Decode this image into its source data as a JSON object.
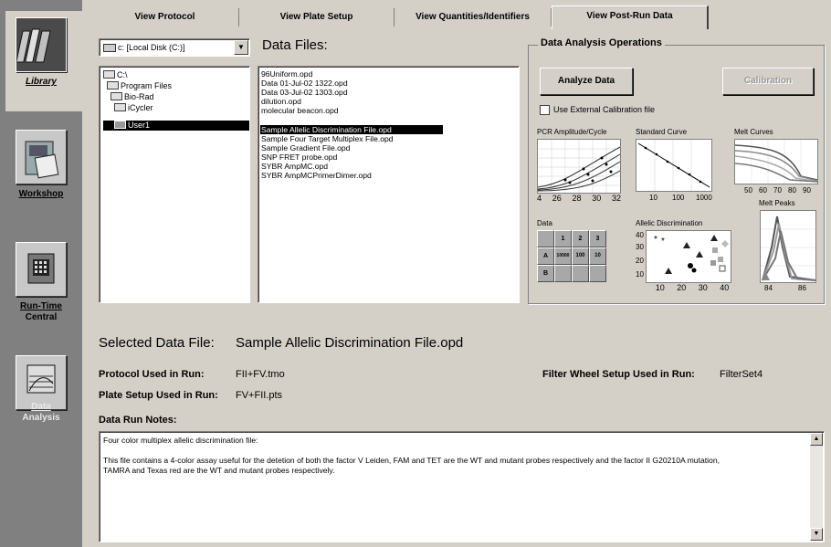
{
  "nav": {
    "library": "Library",
    "workshop": "Workshop",
    "runtime_line1": "Run-Time",
    "runtime_line2": "Central",
    "analysis_line1": "Data",
    "analysis_line2": "Analysis"
  },
  "tabs": [
    "View Protocol",
    "View Plate Setup",
    "View Quantities/Identifiers",
    "View Post-Run Data"
  ],
  "drive": {
    "value": "c: [Local Disk (C:)]"
  },
  "tree": [
    "C:\\",
    "Program Files",
    "Bio-Rad",
    "iCycler",
    "User1"
  ],
  "data_files_header": "Data Files:",
  "files": [
    "96Uniform.opd",
    "Data 01-Jul-02 1322.opd",
    "Data 03-Jul-02 1303.opd",
    "dilution.opd",
    "molecular beacon.opd",
    "Sample Allelic Discrimination File.opd",
    "Sample Four Target Multiplex File.opd",
    "Sample Gradient File.opd",
    "SNP FRET probe.opd",
    "SYBR AmpMC.opd",
    "SYBR AmpMCPrimerDimer.opd"
  ],
  "ops": {
    "title": "Data Analysis Operations",
    "analyze": "Analyze Data",
    "calibration": "Calibration",
    "use_external": "Use External  Calibration file",
    "pcr": "PCR Amplitude/Cycle",
    "pcr_ticks": [
      "4",
      "26",
      "28",
      "30",
      "32"
    ],
    "std": "Standard Curve",
    "std_ticks": [
      "10",
      "100",
      "1000"
    ],
    "melt": "Melt Curves",
    "melt_ticks": [
      "50",
      "60",
      "70",
      "80",
      "90"
    ],
    "melt_peaks": "Melt Peaks",
    "peak_ticks": [
      "84",
      "86"
    ],
    "data": "Data",
    "grid_cols": [
      "1",
      "2",
      "3"
    ],
    "grid_rows": [
      "A",
      "B"
    ],
    "grid_vals": [
      "10000",
      "100",
      "10"
    ],
    "allelic": "Allelic Discrimination",
    "allelic_y": [
      "40",
      "30",
      "20",
      "10"
    ],
    "allelic_x": [
      "10",
      "20",
      "30",
      "40"
    ]
  },
  "selected": {
    "label": "Selected Data File:",
    "value": "Sample Allelic Discrimination File.opd"
  },
  "protocol": {
    "label": "Protocol Used in Run:",
    "value": "FII+FV.tmo"
  },
  "plate": {
    "label": "Plate Setup Used in Run:",
    "value": "FV+FII.pts"
  },
  "filter": {
    "label": "Filter Wheel Setup Used in Run:",
    "value": "FilterSet4"
  },
  "notes": {
    "label": "Data Run Notes:",
    "line1": "Four color multiplex allelic discrimination file:",
    "line2": "This file contains a 4-color assay useful for the detetion of both the factor V Leiden, FAM and TET are the WT and mutant probes respectively and the factor II G20210A mutation,",
    "line3": "TAMRA and Texas red are the WT and mutant probes respectively."
  },
  "colors": {
    "nav_bg": "#808080",
    "face": "#d4d0c8",
    "select": "#000000"
  }
}
